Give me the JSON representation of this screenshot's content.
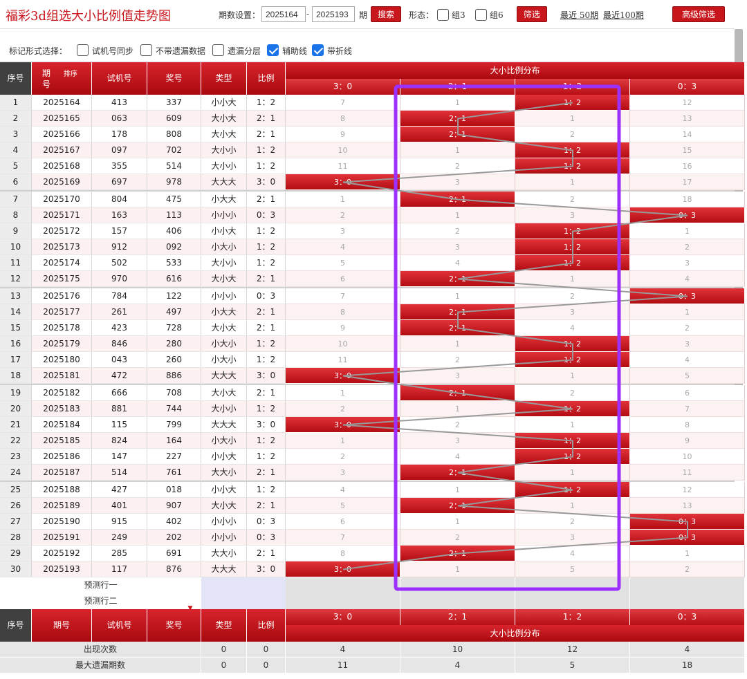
{
  "page_title": "福彩3d组选大小比例值走势图",
  "toolbar": {
    "period_label": "期数设置：",
    "period_start": "2025164",
    "period_dash": "-",
    "period_end": "2025193",
    "period_unit": "期",
    "search_label": "搜索",
    "form_label": "形态：",
    "group3_label": "组3",
    "group6_label": "组6",
    "filter_label": "筛选",
    "recent50_label": "最近 50期",
    "recent100_label": "最近100期",
    "advanced_label": "高级筛选"
  },
  "options": {
    "label": "标记形式选择：",
    "items": [
      {
        "label": "试机号同步",
        "checked": false
      },
      {
        "label": "不带遗漏数据",
        "checked": false
      },
      {
        "label": "遗漏分层",
        "checked": false
      },
      {
        "label": "辅助线",
        "checked": true
      },
      {
        "label": "带折线",
        "checked": true
      }
    ]
  },
  "table": {
    "headers": {
      "index": "序号",
      "issue": "期号",
      "sort": "排序",
      "test": "试机号",
      "draw": "奖号",
      "type": "类型",
      "ratio": "比例",
      "distribution": "大小比例分布"
    },
    "ratio_columns": [
      "3：0",
      "2：1",
      "1：2",
      "0：3"
    ],
    "rows": [
      {
        "idx": "1",
        "issue": "2025164",
        "test": "413",
        "draw": "337",
        "type": "小小大",
        "ratio": "1：2",
        "hit": 2,
        "miss": [
          "7",
          "1",
          "1：2",
          "12"
        ]
      },
      {
        "idx": "2",
        "issue": "2025165",
        "test": "063",
        "draw": "609",
        "type": "大小大",
        "ratio": "2：1",
        "hit": 1,
        "miss": [
          "8",
          "2：1",
          "1",
          "13"
        ]
      },
      {
        "idx": "3",
        "issue": "2025166",
        "test": "178",
        "draw": "808",
        "type": "大小大",
        "ratio": "2：1",
        "hit": 1,
        "miss": [
          "9",
          "2：1",
          "2",
          "14"
        ]
      },
      {
        "idx": "4",
        "issue": "2025167",
        "test": "097",
        "draw": "702",
        "type": "大小小",
        "ratio": "1：2",
        "hit": 2,
        "miss": [
          "10",
          "1",
          "1：2",
          "15"
        ]
      },
      {
        "idx": "5",
        "issue": "2025168",
        "test": "355",
        "draw": "514",
        "type": "大小小",
        "ratio": "1：2",
        "hit": 2,
        "miss": [
          "11",
          "2",
          "1：2",
          "16"
        ]
      },
      {
        "idx": "6",
        "issue": "2025169",
        "test": "697",
        "draw": "978",
        "type": "大大大",
        "ratio": "3：0",
        "hit": 0,
        "miss": [
          "3：0",
          "3",
          "1",
          "17"
        ]
      },
      {
        "idx": "7",
        "issue": "2025170",
        "test": "804",
        "draw": "475",
        "type": "小大大",
        "ratio": "2：1",
        "hit": 1,
        "miss": [
          "1",
          "2：1",
          "2",
          "18"
        ]
      },
      {
        "idx": "8",
        "issue": "2025171",
        "test": "163",
        "draw": "113",
        "type": "小小小",
        "ratio": "0：3",
        "hit": 3,
        "miss": [
          "2",
          "1",
          "3",
          "0：3"
        ]
      },
      {
        "idx": "9",
        "issue": "2025172",
        "test": "157",
        "draw": "406",
        "type": "小小大",
        "ratio": "1：2",
        "hit": 2,
        "miss": [
          "3",
          "2",
          "1：2",
          "1"
        ]
      },
      {
        "idx": "10",
        "issue": "2025173",
        "test": "912",
        "draw": "092",
        "type": "小大小",
        "ratio": "1：2",
        "hit": 2,
        "miss": [
          "4",
          "3",
          "1：2",
          "2"
        ]
      },
      {
        "idx": "11",
        "issue": "2025174",
        "test": "502",
        "draw": "533",
        "type": "大小小",
        "ratio": "1：2",
        "hit": 2,
        "miss": [
          "5",
          "4",
          "1：2",
          "3"
        ]
      },
      {
        "idx": "12",
        "issue": "2025175",
        "test": "970",
        "draw": "616",
        "type": "大小大",
        "ratio": "2：1",
        "hit": 1,
        "miss": [
          "6",
          "2：1",
          "1",
          "4"
        ]
      },
      {
        "idx": "13",
        "issue": "2025176",
        "test": "784",
        "draw": "122",
        "type": "小小小",
        "ratio": "0：3",
        "hit": 3,
        "miss": [
          "7",
          "1",
          "2",
          "0：3"
        ]
      },
      {
        "idx": "14",
        "issue": "2025177",
        "test": "261",
        "draw": "497",
        "type": "小大大",
        "ratio": "2：1",
        "hit": 1,
        "miss": [
          "8",
          "2：1",
          "3",
          "1"
        ]
      },
      {
        "idx": "15",
        "issue": "2025178",
        "test": "423",
        "draw": "728",
        "type": "大小大",
        "ratio": "2：1",
        "hit": 1,
        "miss": [
          "9",
          "2：1",
          "4",
          "2"
        ]
      },
      {
        "idx": "16",
        "issue": "2025179",
        "test": "846",
        "draw": "280",
        "type": "小大小",
        "ratio": "1：2",
        "hit": 2,
        "miss": [
          "10",
          "1",
          "1：2",
          "3"
        ]
      },
      {
        "idx": "17",
        "issue": "2025180",
        "test": "043",
        "draw": "260",
        "type": "小大小",
        "ratio": "1：2",
        "hit": 2,
        "miss": [
          "11",
          "2",
          "1：2",
          "4"
        ]
      },
      {
        "idx": "18",
        "issue": "2025181",
        "test": "472",
        "draw": "886",
        "type": "大大大",
        "ratio": "3：0",
        "hit": 0,
        "miss": [
          "3：0",
          "3",
          "1",
          "5"
        ]
      },
      {
        "idx": "19",
        "issue": "2025182",
        "test": "666",
        "draw": "708",
        "type": "大小大",
        "ratio": "2：1",
        "hit": 1,
        "miss": [
          "1",
          "2：1",
          "2",
          "6"
        ]
      },
      {
        "idx": "20",
        "issue": "2025183",
        "test": "881",
        "draw": "744",
        "type": "大小小",
        "ratio": "1：2",
        "hit": 2,
        "miss": [
          "2",
          "1",
          "1：2",
          "7"
        ]
      },
      {
        "idx": "21",
        "issue": "2025184",
        "test": "115",
        "draw": "799",
        "type": "大大大",
        "ratio": "3：0",
        "hit": 0,
        "miss": [
          "3：0",
          "2",
          "1",
          "8"
        ]
      },
      {
        "idx": "22",
        "issue": "2025185",
        "test": "824",
        "draw": "164",
        "type": "小大小",
        "ratio": "1：2",
        "hit": 2,
        "miss": [
          "1",
          "3",
          "1：2",
          "9"
        ]
      },
      {
        "idx": "23",
        "issue": "2025186",
        "test": "147",
        "draw": "227",
        "type": "小小大",
        "ratio": "1：2",
        "hit": 2,
        "miss": [
          "2",
          "4",
          "1：2",
          "10"
        ]
      },
      {
        "idx": "24",
        "issue": "2025187",
        "test": "514",
        "draw": "761",
        "type": "大大小",
        "ratio": "2：1",
        "hit": 1,
        "miss": [
          "3",
          "2：1",
          "1",
          "11"
        ]
      },
      {
        "idx": "25",
        "issue": "2025188",
        "test": "427",
        "draw": "018",
        "type": "小小大",
        "ratio": "1：2",
        "hit": 2,
        "miss": [
          "4",
          "1",
          "1：2",
          "12"
        ]
      },
      {
        "idx": "26",
        "issue": "2025189",
        "test": "401",
        "draw": "907",
        "type": "大小大",
        "ratio": "2：1",
        "hit": 1,
        "miss": [
          "5",
          "2：1",
          "1",
          "13"
        ]
      },
      {
        "idx": "27",
        "issue": "2025190",
        "test": "915",
        "draw": "402",
        "type": "小小小",
        "ratio": "0：3",
        "hit": 3,
        "miss": [
          "6",
          "1",
          "2",
          "0：3"
        ]
      },
      {
        "idx": "28",
        "issue": "2025191",
        "test": "249",
        "draw": "202",
        "type": "小小小",
        "ratio": "0：3",
        "hit": 3,
        "miss": [
          "7",
          "2",
          "3",
          "0：3"
        ]
      },
      {
        "idx": "29",
        "issue": "2025192",
        "test": "285",
        "draw": "691",
        "type": "大大小",
        "ratio": "2：1",
        "hit": 1,
        "miss": [
          "8",
          "2：1",
          "4",
          "1"
        ]
      },
      {
        "idx": "30",
        "issue": "2025193",
        "test": "117",
        "draw": "876",
        "type": "大大大",
        "ratio": "3：0",
        "hit": 0,
        "miss": [
          "3：0",
          "1",
          "5",
          "2"
        ]
      }
    ],
    "predict_rows": [
      "预测行一",
      "预测行二"
    ],
    "stats": [
      {
        "label": "出现次数",
        "type": "0",
        "ratio": "0",
        "values": [
          "4",
          "10",
          "12",
          "4"
        ]
      },
      {
        "label": "最大遗漏期数",
        "type": "0",
        "ratio": "0",
        "values": [
          "11",
          "4",
          "5",
          "18"
        ]
      }
    ]
  },
  "colors": {
    "brand_red": "#c8161d",
    "highlight_box": "#9b30ff",
    "trend_line": "#999999"
  }
}
